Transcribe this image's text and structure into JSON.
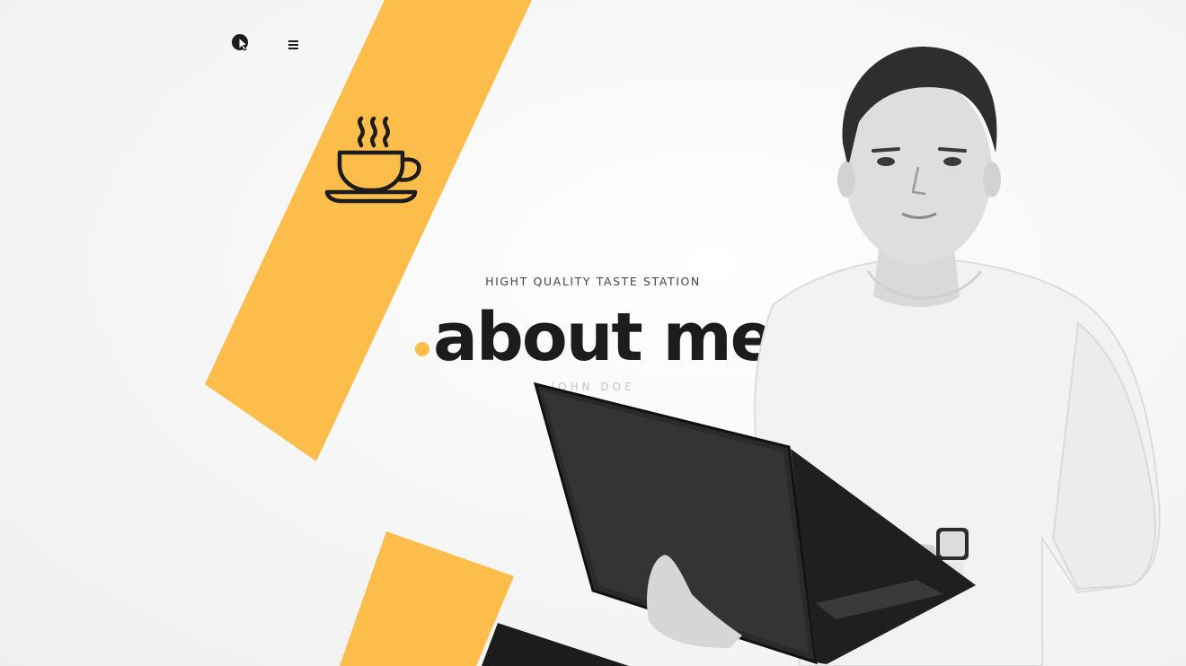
{
  "header": {
    "logo_icon": "pointer-logo-icon",
    "menu_icon": "hamburger-menu-icon"
  },
  "hero": {
    "tagline": "HIGHT QUALITY TASTE STATION",
    "title": "about me",
    "name": "JOHN DOE",
    "illustration_icon": "coffee-cup-icon"
  },
  "colors": {
    "accent": "#fdbd4a",
    "dark": "#1c1c1c",
    "background": "#f6f6f6"
  }
}
